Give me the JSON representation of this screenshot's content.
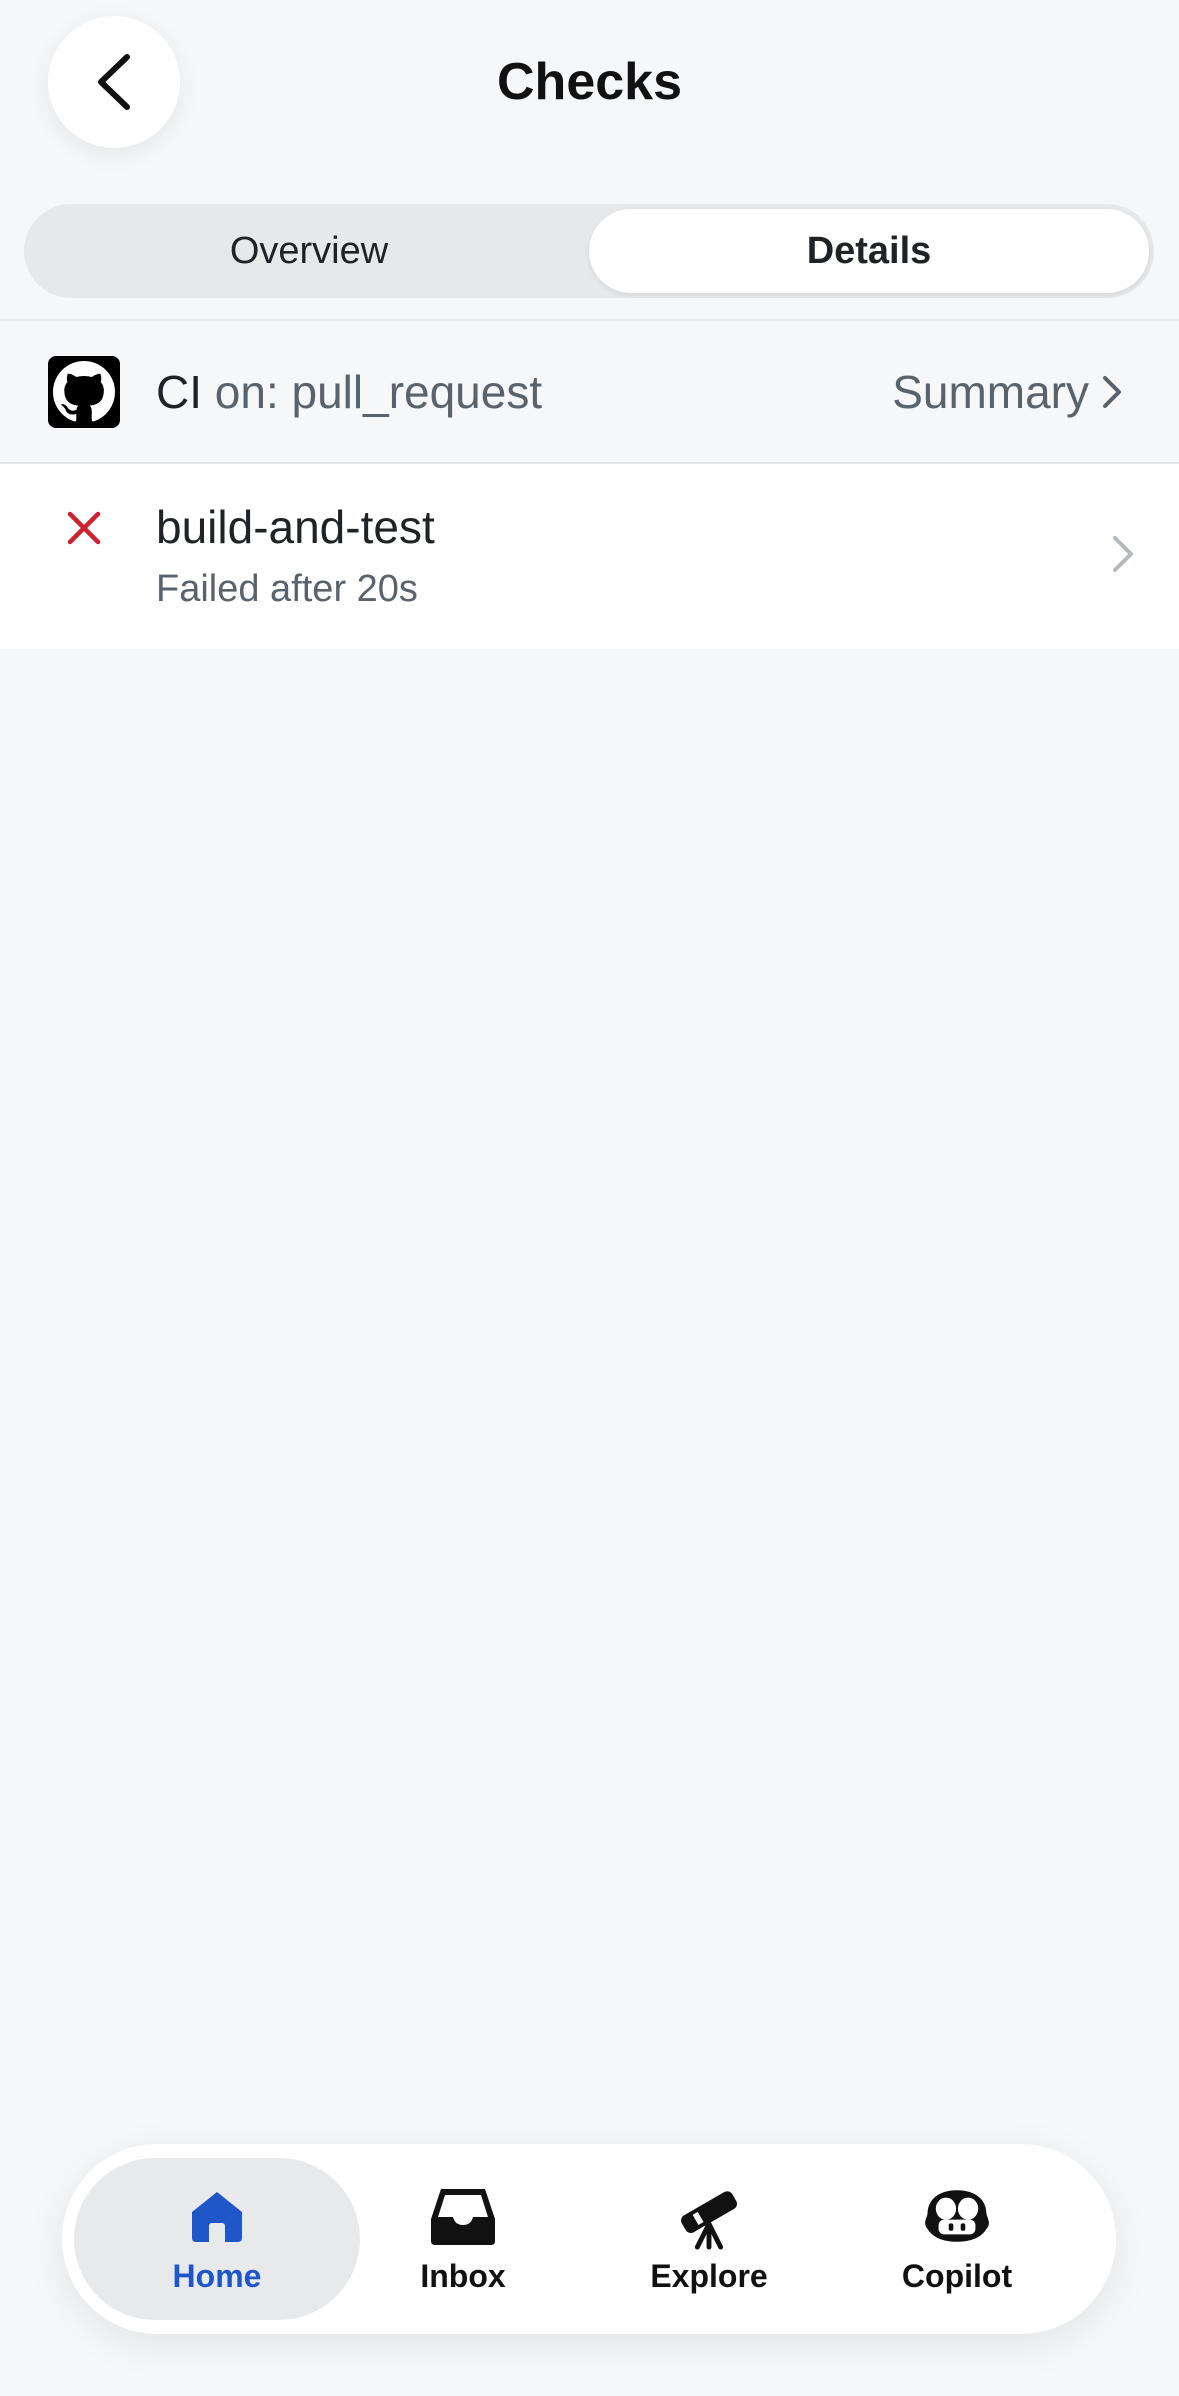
{
  "header": {
    "title": "Checks",
    "back_icon": "chevron-left-icon"
  },
  "segmented": {
    "tabs": [
      {
        "label": "Overview",
        "active": false
      },
      {
        "label": "Details",
        "active": true
      }
    ]
  },
  "workflow": {
    "name": "CI",
    "trigger": "on: pull_request",
    "summary_label": "Summary",
    "logo": "github-logo-icon"
  },
  "jobs": [
    {
      "name": "build-and-test",
      "status": "Failed after 20s",
      "status_color": "#cf222e"
    }
  ],
  "tabbar": {
    "tabs": [
      {
        "label": "Home",
        "icon": "home-icon",
        "active": true
      },
      {
        "label": "Inbox",
        "icon": "inbox-icon",
        "active": false
      },
      {
        "label": "Explore",
        "icon": "telescope-icon",
        "active": false
      },
      {
        "label": "Copilot",
        "icon": "copilot-icon",
        "active": false
      }
    ]
  },
  "colors": {
    "background": "#f5f7f9",
    "accent": "#1f57c9",
    "fail": "#cf222e",
    "muted_text": "#59636e"
  }
}
